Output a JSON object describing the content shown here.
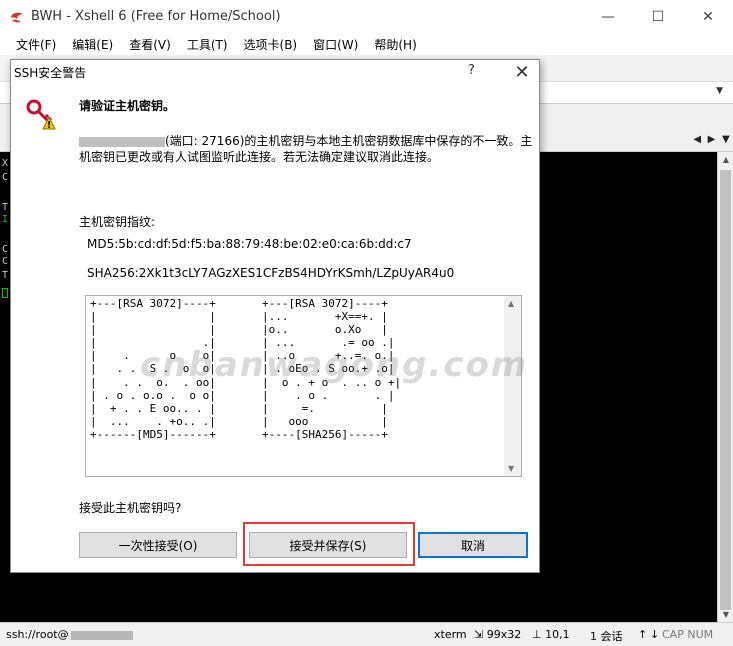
{
  "window": {
    "title": "BWH - Xshell 6 (Free for Home/School)",
    "controls": {
      "minimize": "—",
      "maximize": "☐",
      "close": "✕"
    }
  },
  "menu": {
    "items": [
      "文件(F)",
      "编辑(E)",
      "查看(V)",
      "工具(T)",
      "选项卡(B)",
      "窗口(W)",
      "帮助(H)"
    ]
  },
  "terminal_fragments": [
    "X",
    "C",
    "T",
    "I",
    "C",
    "C",
    "T"
  ],
  "dialog": {
    "title": "SSH安全警告",
    "help": "?",
    "close": "✕",
    "heading": "请验证主机密钥。",
    "message_suffix": "(端口: 27166)的主机密钥与本地主机密钥数据库中保存的不一致。主机密钥已更改或有人试图监听此连接。若无法确定建议取消此连接。",
    "fingerprint_label": "主机密钥指纹:",
    "md5": "MD5:5b:cd:df:5d:f5:ba:88:79:48:be:02:e0:ca:6b:dd:c7",
    "sha256": "SHA256:2Xk1t3cLY7AGzXES1CFzBS4HDYrKSmh/LZpUyAR4u0",
    "randomart_md5": "+---[RSA 3072]----+\n|                 |\n|                 |\n|                .|\n|    .      o    o|\n|   . .  S .  o  o|\n|    . .  o.  . oo|\n| . o . o.o .  o o|\n|  + . . E oo.. . |\n|  ...    . +o.. .|\n+------[MD5]------+",
    "randomart_sha": "+---[RSA 3072]----+\n|...       +X==+. |\n|o..       o.Xo   |\n| ...       .= oo .|\n| ..o      +..=. o.|\n| . oEo . S oo.+ .o|\n|  o . + o  . .. o +|\n|    . o .       . |\n|     =.          |\n|   ooo           |\n+----[SHA256]-----+",
    "question": "接受此主机密钥吗?",
    "buttons": {
      "accept_once": "一次性接受(O)",
      "accept_save": "接受并保存(S)",
      "cancel": "取消"
    }
  },
  "status": {
    "connection": "ssh://root@",
    "terminal_type": "xterm",
    "size": "99x32",
    "cursor_pos": "10,1",
    "sessions": "1 会话",
    "caps": "CAP NUM"
  },
  "watermark": "cnbanwagong.com",
  "colors": {
    "accent": "#0078d7",
    "highlight": "#e53935",
    "terminal_bg": "#000000"
  }
}
